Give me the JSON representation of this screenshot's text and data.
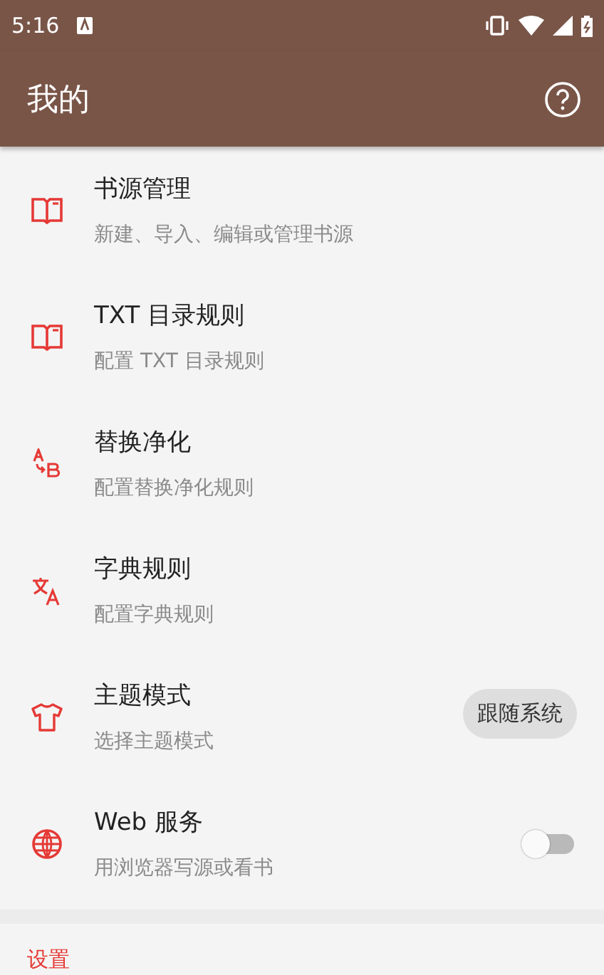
{
  "status_bar": {
    "time": "5:16"
  },
  "app_bar": {
    "title": "我的"
  },
  "items": [
    {
      "title": "书源管理",
      "subtitle": "新建、导入、编辑或管理书源"
    },
    {
      "title": "TXT 目录规则",
      "subtitle": "配置 TXT 目录规则"
    },
    {
      "title": "替换净化",
      "subtitle": "配置替换净化规则"
    },
    {
      "title": "字典规则",
      "subtitle": "配置字典规则"
    },
    {
      "title": "主题模式",
      "subtitle": "选择主题模式",
      "kind": "value",
      "value": "跟随系统"
    },
    {
      "title": "Web 服务",
      "subtitle": "用浏览器写源或看书",
      "kind": "switch",
      "on": false
    }
  ],
  "section_header": "设置"
}
